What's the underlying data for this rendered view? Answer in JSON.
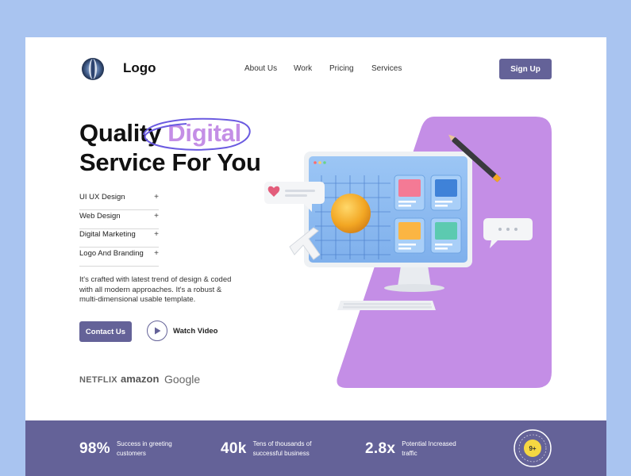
{
  "header": {
    "logo_text": "Logo",
    "nav": [
      {
        "label": "About Us"
      },
      {
        "label": "Work"
      },
      {
        "label": "Pricing"
      },
      {
        "label": "Services"
      }
    ],
    "signup_label": "Sign Up"
  },
  "hero": {
    "title_part1": "Quality ",
    "title_accent": "Digital",
    "title_line2": "Service For You",
    "services": [
      {
        "label": "UI UX Design",
        "icon": "plus-icon"
      },
      {
        "label": "Web Design",
        "icon": "plus-icon"
      },
      {
        "label": "Digital Marketing",
        "icon": "plus-icon"
      },
      {
        "label": "Logo And Branding",
        "icon": "plus-icon"
      }
    ],
    "plus_symbol": "+",
    "description": "It's crafted with latest trend of design & coded with all modern approaches. It's a robust & multi-dimensional usable template.",
    "contact_label": "Contact Us",
    "watch_label": "Watch Video"
  },
  "brands": [
    "NETFLIX",
    "amazon",
    "Google"
  ],
  "stats": [
    {
      "value": "98%",
      "label": "Success in greeting customers"
    },
    {
      "value": "40k",
      "label": "Tens of thousands of successful business"
    },
    {
      "value": "2.8x",
      "label": "Potential Increased traffic"
    }
  ],
  "badge_text": "9+",
  "colors": {
    "primary": "#646298",
    "accent": "#c48ee6",
    "purple_panel": "#c48ee6",
    "background": "#a9c4f0"
  }
}
